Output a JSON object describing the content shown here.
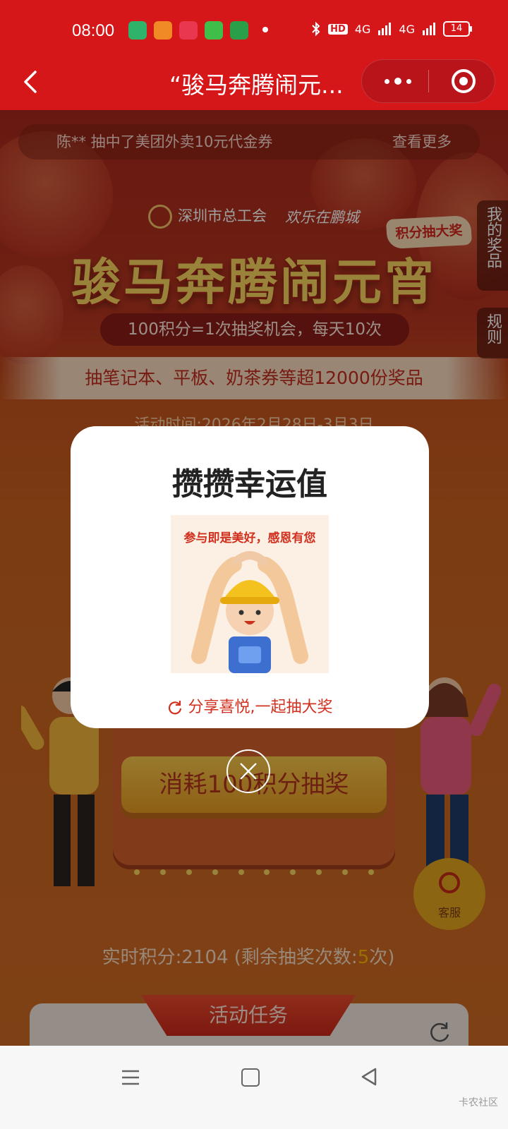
{
  "status_bar": {
    "time": "08:00",
    "network_hd": "HD",
    "signal_1": "4G",
    "signal_2": "4G",
    "battery": "14"
  },
  "navbar": {
    "title": "“骏马奔腾闹元..."
  },
  "ticker": {
    "text": "陈** 抽中了美团外卖10元代金券",
    "more": "查看更多"
  },
  "hero": {
    "org_1": "深圳市总工会",
    "org_2": "欢乐在鹏城",
    "badge": "积分抽大奖",
    "title": "骏马奔腾闹元宵",
    "rule": "100积分=1次抽奖机会，每天10次",
    "prizes": "抽笔记本、平板、奶茶券等超12000份奖品",
    "activity_time": "活动时间:2026年2月28日-3月3日"
  },
  "side_tabs": {
    "my_prizes": "我的奖品",
    "rules": "规则"
  },
  "draw": {
    "button": "消耗100积分抽奖",
    "live_points_prefix": "实时积分:2104 (剩余抽奖次数:",
    "remaining": "5",
    "live_points_suffix": "次)"
  },
  "service": {
    "label": "客服"
  },
  "tasks": {
    "title": "活动任务"
  },
  "modal": {
    "title": "攒攒幸运值",
    "image_caption": "参与即是美好，感恩有您",
    "share_text": "分享喜悦,一起抽大奖"
  },
  "watermark": "卡农社区",
  "colors": {
    "brand_red": "#d6171a",
    "gold": "#f7d35e",
    "modal_accent": "#d2301e"
  }
}
